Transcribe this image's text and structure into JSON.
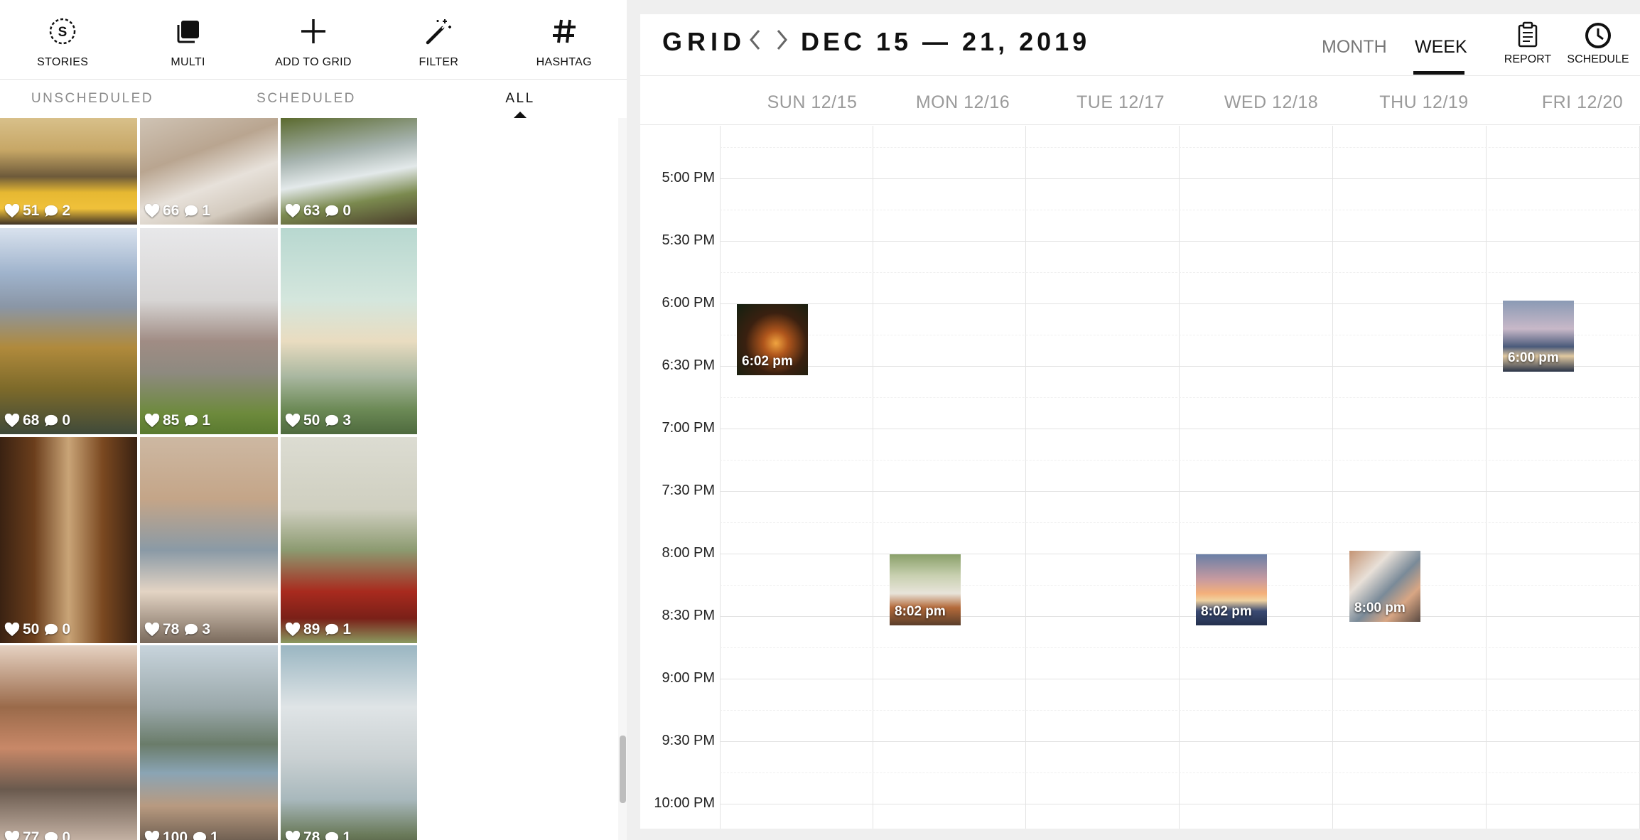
{
  "toolbar": {
    "items": [
      {
        "label": "STORIES",
        "icon": "stories-icon"
      },
      {
        "label": "MULTI",
        "icon": "multi-icon"
      },
      {
        "label": "ADD TO GRID",
        "icon": "plus-icon"
      },
      {
        "label": "FILTER",
        "icon": "magic-wand-icon"
      },
      {
        "label": "HASHTAG",
        "icon": "hashtag-icon"
      }
    ]
  },
  "tabs": [
    {
      "label": "UNSCHEDULED",
      "active": false
    },
    {
      "label": "SCHEDULED",
      "active": false
    },
    {
      "label": "ALL",
      "active": true
    }
  ],
  "posts": [
    {
      "likes": "51",
      "comments": "2",
      "scene": "festival"
    },
    {
      "likes": "66",
      "comments": "1",
      "scene": "stairs"
    },
    {
      "likes": "63",
      "comments": "0",
      "scene": "creek"
    },
    {
      "likes": "68",
      "comments": "0",
      "scene": "mountain-valley"
    },
    {
      "likes": "85",
      "comments": "1",
      "scene": "hotel-cliff"
    },
    {
      "likes": "50",
      "comments": "3",
      "scene": "cross-sunset"
    },
    {
      "likes": "50",
      "comments": "0",
      "scene": "cabin-window"
    },
    {
      "likes": "78",
      "comments": "3",
      "scene": "couple-selfie"
    },
    {
      "likes": "89",
      "comments": "1",
      "scene": "red-car"
    },
    {
      "likes": "77",
      "comments": "0",
      "scene": "village-street"
    },
    {
      "likes": "100",
      "comments": "1",
      "scene": "lake-castle"
    },
    {
      "likes": "78",
      "comments": "1",
      "scene": "cross-clouds"
    }
  ],
  "calendar": {
    "brand": "GRID",
    "range": "DEC 15 — 21, 2019",
    "views": [
      {
        "label": "MONTH",
        "active": false
      },
      {
        "label": "WEEK",
        "active": true
      }
    ],
    "actions": [
      {
        "label": "REPORT",
        "icon": "clipboard-icon"
      },
      {
        "label": "SCHEDULE",
        "icon": "clock-icon"
      }
    ],
    "days": [
      "SUN 12/15",
      "MON 12/16",
      "TUE 12/17",
      "WED 12/18",
      "THU 12/19",
      "FRI 12/20"
    ],
    "times": [
      "5:00 PM",
      "5:30 PM",
      "6:00 PM",
      "6:30 PM",
      "7:00 PM",
      "7:30 PM",
      "8:00 PM",
      "8:30 PM",
      "9:00 PM",
      "9:30 PM",
      "10:00 PM"
    ],
    "events": [
      {
        "day": 0,
        "time": "6:02 pm",
        "hour": 18.03,
        "scene": "night-cabin"
      },
      {
        "day": 1,
        "time": "8:02 pm",
        "hour": 20.03,
        "scene": "chalet"
      },
      {
        "day": 3,
        "time": "8:02 pm",
        "hour": 20.03,
        "scene": "sunset-lake"
      },
      {
        "day": 4,
        "time": "8:00 pm",
        "hour": 20.0,
        "scene": "photos-hand"
      },
      {
        "day": 5,
        "time": "6:00 pm",
        "hour": 18.0,
        "scene": "harbor-dusk"
      }
    ]
  }
}
